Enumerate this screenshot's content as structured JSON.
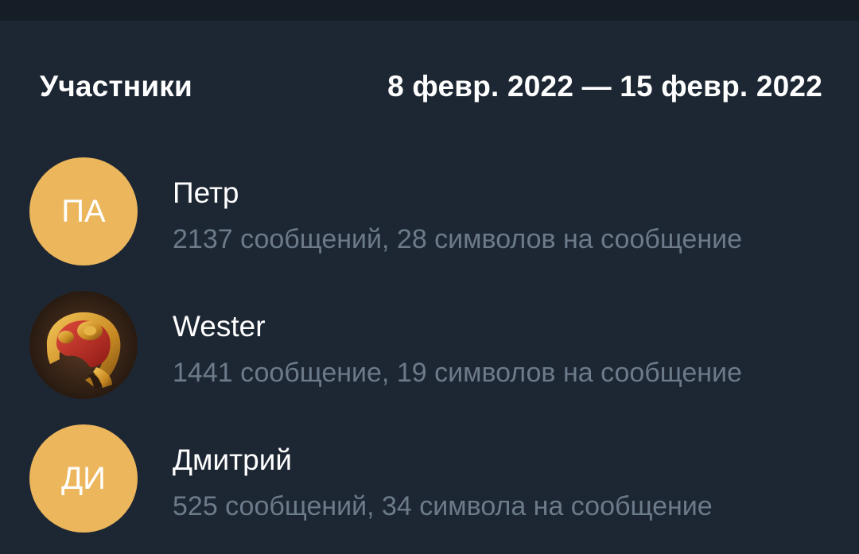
{
  "header": {
    "title": "Участники",
    "date_range": "8 февр. 2022 — 15 февр. 2022"
  },
  "members": [
    {
      "initials": "ПА",
      "name": "Петр",
      "stats": "2137 сообщений, 28 символов на сообщение",
      "avatar_color": "#ecb65c"
    },
    {
      "initials": "",
      "name": "Wester",
      "stats": "1441 сообщение, 19 символов на сообщение",
      "avatar_icon": "golden-red-gauntlet-avatar"
    },
    {
      "initials": "ДИ",
      "name": "Дмитрий",
      "stats": "525 сообщений, 34 символа на сообщение",
      "avatar_color": "#ecb65c"
    }
  ],
  "colors": {
    "background": "#1d2733",
    "top_strip": "#151d27",
    "secondary_text": "#6c7a89",
    "avatar": "#ecb65c"
  }
}
